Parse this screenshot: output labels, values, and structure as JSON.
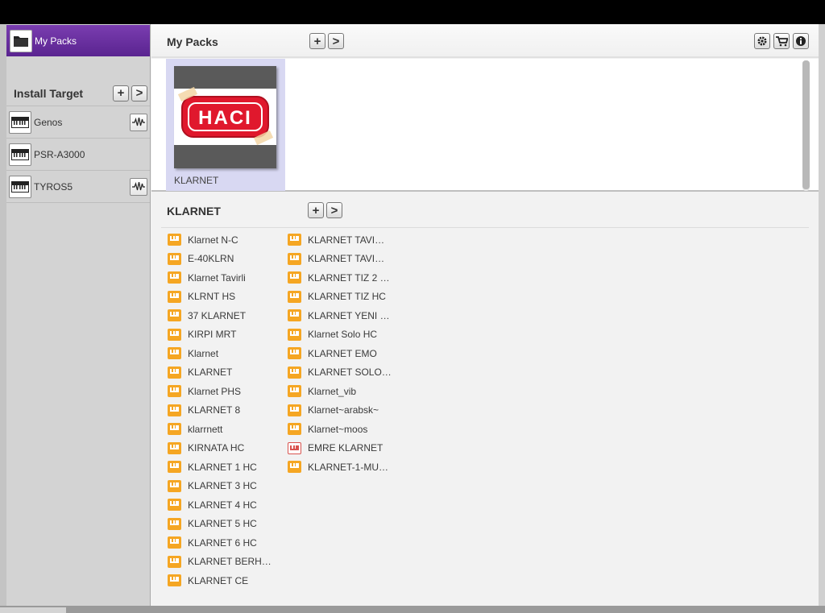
{
  "sidebar": {
    "my_packs_label": "My Packs",
    "install_target_title": "Install Target",
    "targets": [
      {
        "name": "Genos",
        "has_wave": true
      },
      {
        "name": "PSR-A3000",
        "has_wave": false
      },
      {
        "name": "TYROS5",
        "has_wave": true
      }
    ]
  },
  "packs_header": {
    "title": "My Packs",
    "add_label": "+",
    "next_label": ">"
  },
  "packs": [
    {
      "name": "KLARNET",
      "logo_text": "HACI"
    }
  ],
  "voices_header": {
    "title": "KLARNET",
    "add_label": "+",
    "next_label": ">"
  },
  "voices_col1": [
    "Klarnet  N-C",
    "E-40KLRN",
    "Klarnet Tavirli",
    "KLRNT HS",
    "37 KLARNET",
    "KIRPI MRT",
    "Klarnet",
    "KLARNET",
    "Klarnet PHS",
    "KLARNET 8",
    "klarrnett",
    "KIRNATA HC",
    "KLARNET 1 HC",
    "KLARNET 3 HC",
    "KLARNET 4 HC",
    "KLARNET 5 HC",
    "KLARNET 6 HC",
    "KLARNET BERH…",
    "KLARNET CE"
  ],
  "voices_col2": [
    "KLARNET TAVI…",
    "KLARNET TAVI…",
    "KLARNET TIZ 2 …",
    "KLARNET TIZ HC",
    "KLARNET YENI …",
    "Klarnet Solo HC",
    "KLARNET EMO",
    "KLARNET SOLO…",
    "Klarnet_vib",
    "Klarnet~arabsk~",
    "Klarnet~moos",
    "EMRE KLARNET",
    "KLARNET-1-MU…"
  ],
  "voices_col2_alt_index": 11,
  "colors": {
    "accent_purple": "#6a2ea0",
    "voice_icon": "#f5a623",
    "voice_icon_alt": "#d9534f",
    "pack_selected": "#d8d8f2",
    "logo_red": "#e0182d"
  },
  "icons": {
    "settings": "gear-icon",
    "cart": "cart-icon",
    "info": "info-icon"
  }
}
